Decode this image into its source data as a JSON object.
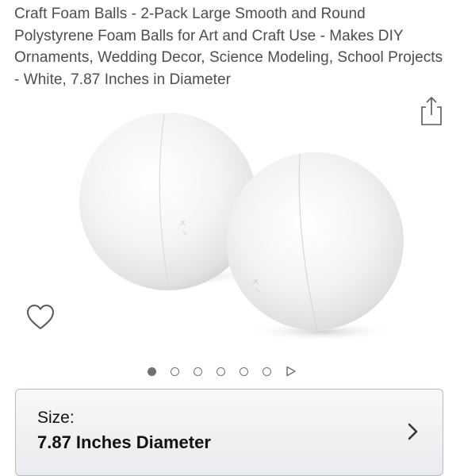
{
  "product": {
    "title": "Craft Foam Balls - 2-Pack Large Smooth and Round Polystyrene Foam Balls for Art and Craft Use - Makes DIY Ornaments, Wedding Decor, Science Modeling, School Projects - White, 7.87 Inches in Diameter"
  },
  "icons": {
    "share": "share-icon",
    "wishlist": "heart-icon",
    "next_slide": "play-triangle-icon",
    "chevron": "chevron-right-icon"
  },
  "carousel": {
    "total_images": 6,
    "active_index": 0
  },
  "size": {
    "label": "Size:",
    "value": "7.87 Inches Diameter"
  },
  "colors": {
    "title_text": "#4a4d52",
    "dot": "#6f7377",
    "selector_border": "#b9bcc0"
  }
}
